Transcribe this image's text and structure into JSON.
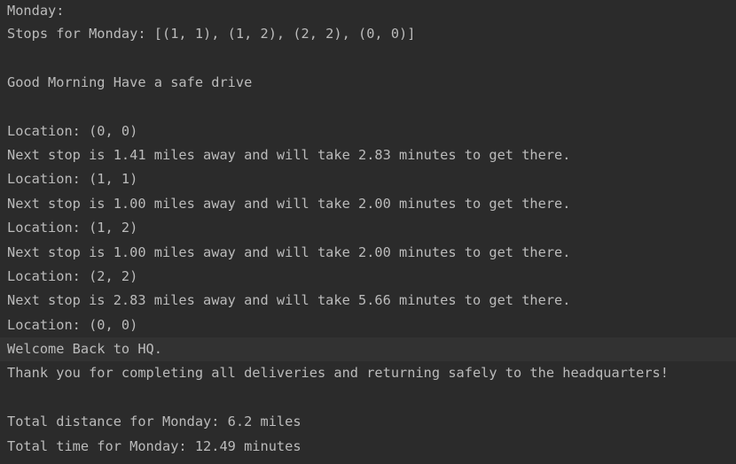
{
  "console": {
    "lines": [
      "Monday:",
      "Stops for Monday: [(1, 1), (1, 2), (2, 2), (0, 0)]",
      "",
      "Good Morning Have a safe drive",
      "",
      "Location: (0, 0)",
      "Next stop is 1.41 miles away and will take 2.83 minutes to get there.",
      "Location: (1, 1)",
      "Next stop is 1.00 miles away and will take 2.00 minutes to get there.",
      "Location: (1, 2)",
      "Next stop is 1.00 miles away and will take 2.00 minutes to get there.",
      "Location: (2, 2)",
      "Next stop is 2.83 miles away and will take 5.66 minutes to get there.",
      "Location: (0, 0)",
      "Welcome Back to HQ.",
      "Thank you for completing all deliveries and returning safely to the headquarters!",
      "",
      "Total distance for Monday: 6.2 miles",
      "Total time for Monday: 12.49 minutes"
    ]
  }
}
